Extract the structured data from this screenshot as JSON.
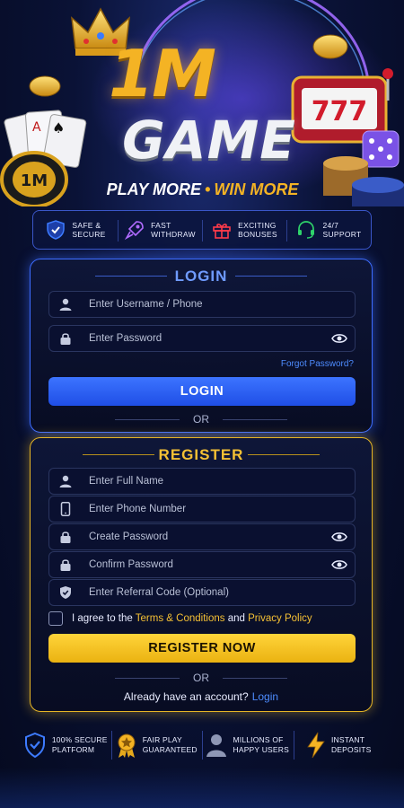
{
  "brand": {
    "logo_top": "1M",
    "logo_bottom": "GAME",
    "tagline_play": "PLAY MORE",
    "tagline_sep": "•",
    "tagline_win": "WIN MORE",
    "chip_label": "1M",
    "slot_digits": "777"
  },
  "features": [
    {
      "icon": "shield-check-icon",
      "line1": "SAFE &",
      "line2": "SECURE",
      "color": "#3d7bff"
    },
    {
      "icon": "rocket-icon",
      "line1": "FAST",
      "line2": "WITHDRAW",
      "color": "#b06bff"
    },
    {
      "icon": "gift-icon",
      "line1": "EXCITING",
      "line2": "BONUSES",
      "color": "#ff3b4a"
    },
    {
      "icon": "headset-icon",
      "line1": "24/7",
      "line2": "SUPPORT",
      "color": "#2fd36a"
    }
  ],
  "login": {
    "title": "LOGIN",
    "username_placeholder": "Enter Username / Phone",
    "password_placeholder": "Enter Password",
    "forgot": "Forgot Password?",
    "button": "LOGIN",
    "or": "OR"
  },
  "register": {
    "title": "REGISTER",
    "fullname_placeholder": "Enter Full Name",
    "phone_placeholder": "Enter Phone Number",
    "create_password_placeholder": "Create Password",
    "confirm_password_placeholder": "Confirm Password",
    "referral_placeholder": "Enter Referral Code (Optional)",
    "agree_prefix": "I agree to the",
    "terms": "Terms & Conditions",
    "and": "and",
    "privacy": "Privacy Policy",
    "button": "REGISTER NOW",
    "or": "OR",
    "already": "Already have an account?",
    "login_link": "Login"
  },
  "bottom_badges": [
    {
      "icon": "shield-check-icon",
      "line1": "100% SECURE",
      "line2": "PLATFORM"
    },
    {
      "icon": "medal-star-icon",
      "line1": "FAIR PLAY",
      "line2": "GUARANTEED"
    },
    {
      "icon": "user-icon",
      "line1": "MILLIONS OF",
      "line2": "HAPPY USERS"
    },
    {
      "icon": "lightning-icon",
      "line1": "INSTANT",
      "line2": "DEPOSITS"
    }
  ],
  "colors": {
    "gold": "#f4b324",
    "blue_accent": "#3d6cff",
    "link_blue": "#4d8cff"
  }
}
